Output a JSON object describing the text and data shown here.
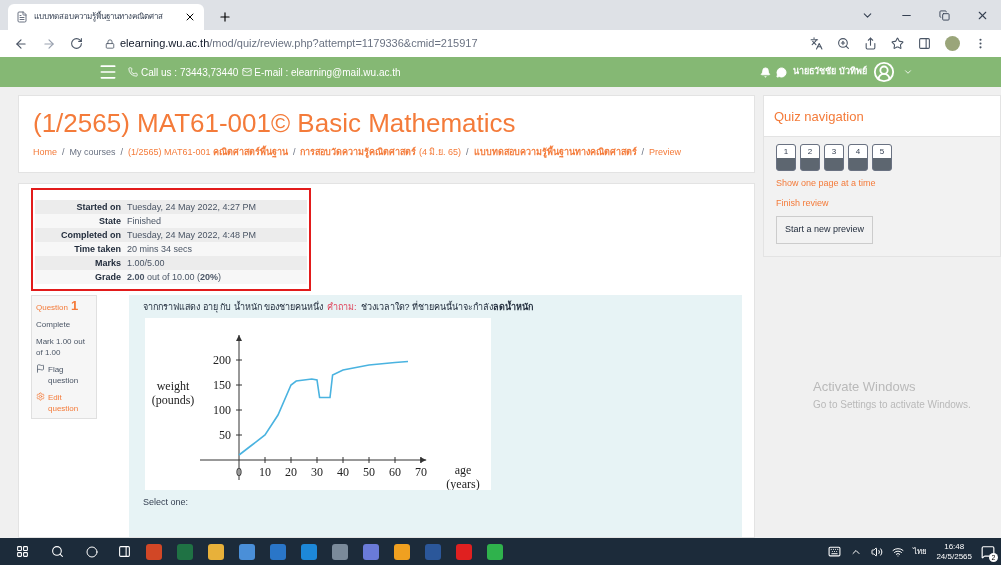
{
  "browser": {
    "tab_title": "แบบทดสอบความรู้พื้นฐานทางคณิตศาส",
    "url_host": "elearning.wu.ac.th",
    "url_path": "/mod/quiz/review.php?attempt=1179336&cmid=215917"
  },
  "navbar": {
    "phone": "Call us : 73443,73440",
    "email": "E-mail : elearning@mail.wu.ac.th",
    "user": "นายธวัชชัย บัวทิพย์"
  },
  "header": {
    "title": "(1/2565) MAT61-001© Basic Mathematics",
    "separator": "/",
    "breadcrumb": [
      {
        "text": "Home",
        "link": true
      },
      {
        "text": "My courses",
        "link": false
      },
      {
        "text": "(1/2565) MAT61-001 **คณิตศาสตร์พื้นฐาน**",
        "link": true
      },
      {
        "text": "**การสอบวัดความรู้คณิตศาสตร์** (4 มิ.ย. 65)",
        "link": true
      },
      {
        "text": "**แบบทดสอบความรู้พื้นฐานทางคณิตศาสตร์**",
        "link": true
      },
      {
        "text": "Preview",
        "link": true
      }
    ]
  },
  "summary": [
    {
      "label": "Started on",
      "value": "Tuesday, 24 May 2022, 4:27 PM"
    },
    {
      "label": "State",
      "value": "Finished"
    },
    {
      "label": "Completed on",
      "value": "Tuesday, 24 May 2022, 4:48 PM"
    },
    {
      "label": "Time taken",
      "value": "20 mins 34 secs"
    },
    {
      "label": "Marks",
      "value": "1.00/5.00"
    },
    {
      "label": "Grade",
      "value": "**2.00** out of 10.00 (**20%**)"
    }
  ],
  "question_info": {
    "word": "Question",
    "number": "1",
    "status": "Complete",
    "mark": "Mark 1.00 out of 1.00",
    "flag": "Flag question",
    "edit": "Edit question"
  },
  "question": {
    "intro": "จากกราฟแสดง อายุ กับ น้ำหนัก ของชายคนหนึ่ง",
    "label": "คำถาม:",
    "text": "ช่วงเวลาใด? ที่ชายคนนี้น่าจะกำลัง**ลดน้ำหนัก**",
    "select_prompt": "Select one:",
    "chart_data": {
      "type": "line",
      "xlabel": "age (years)",
      "ylabel": "weight (pounds)",
      "x": [
        0,
        5,
        10,
        15,
        20,
        22,
        28,
        30,
        31,
        35,
        36,
        40,
        50,
        60,
        65
      ],
      "series": [
        {
          "color": "#4ab3e0",
          "values": [
            10,
            30,
            50,
            90,
            150,
            158,
            162,
            160,
            125,
            125,
            170,
            180,
            190,
            195,
            197
          ]
        }
      ],
      "xlim": [
        -15,
        72
      ],
      "ylim": [
        -40,
        250
      ],
      "xticks": [
        0,
        10,
        20,
        30,
        40,
        50,
        60,
        70
      ],
      "yticks": [
        50,
        100,
        150,
        200
      ]
    }
  },
  "quiz_nav": {
    "title": "Quiz navigation",
    "buttons": [
      {
        "label": "1",
        "answered": true
      },
      {
        "label": "2",
        "answered": true
      },
      {
        "label": "3",
        "answered": true
      },
      {
        "label": "4",
        "answered": true
      },
      {
        "label": "5",
        "answered": true
      }
    ],
    "links": [
      "Show one page at a time",
      "Finish review"
    ],
    "button": "Start a new preview"
  },
  "activation": {
    "title": "Activate Windows",
    "text": "Go to Settings to activate Windows."
  },
  "taskbar": {
    "language": "ไทย",
    "time": "16:48",
    "date": "24/5/2565",
    "notifications": "2"
  }
}
